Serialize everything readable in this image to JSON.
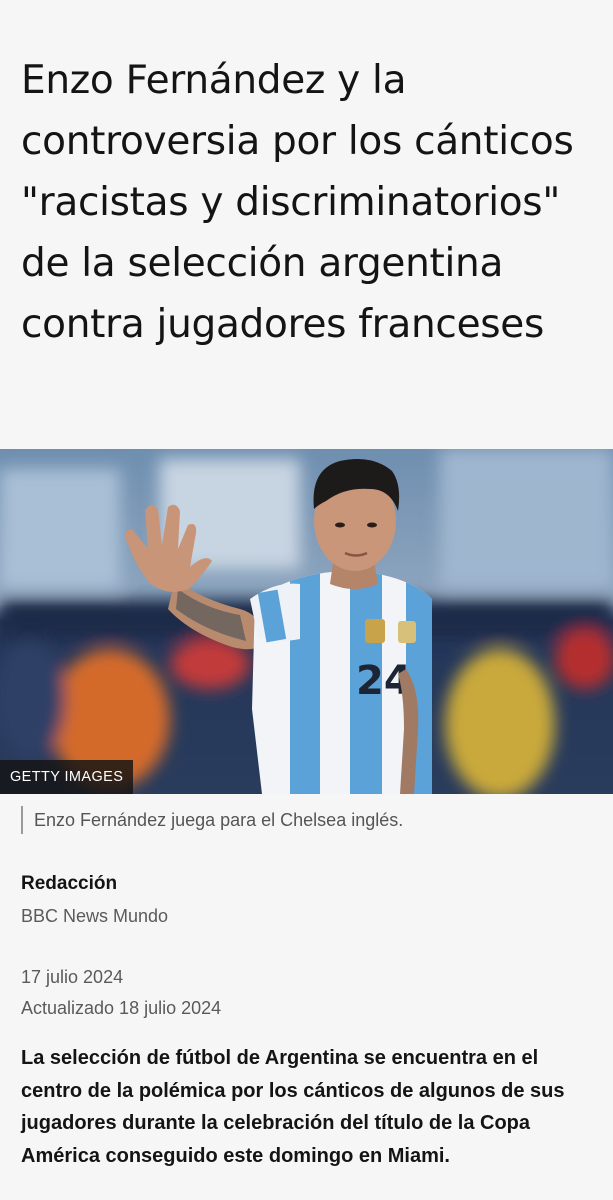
{
  "article": {
    "headline": "Enzo Fernández y la controversia por los cánticos \"racistas y discriminatorios\" de la selección argentina contra jugadores franceses",
    "image": {
      "credit": "GETTY IMAGES",
      "caption": "Enzo Fernández juega para el Chelsea inglés.",
      "jersey_number": "24"
    },
    "byline": {
      "name": "Redacción",
      "organization": "BBC News Mundo"
    },
    "date": "17 julio 2024",
    "updated": "Actualizado 18 julio 2024",
    "lead": "La selección de fútbol de Argentina se encuentra en el centro de la polémica por los cánticos de algunos de sus jugadores durante la celebración del título de la Copa América conseguido este domingo en Miami."
  },
  "colors": {
    "background": "#f6f6f6",
    "text": "#141414",
    "secondary_text": "#5a5a5a",
    "jersey_blue": "#5aa2d8"
  }
}
